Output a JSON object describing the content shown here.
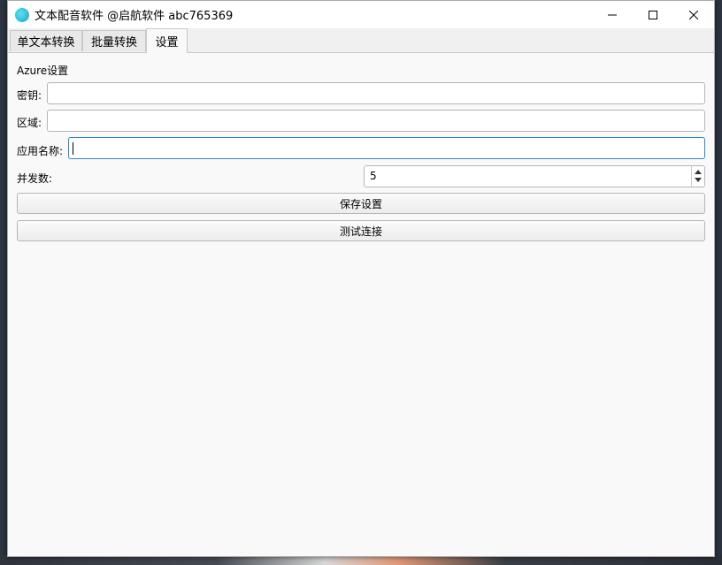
{
  "window": {
    "title": "文本配音软件 @启航软件 abc765369",
    "icon": "app-icon"
  },
  "tabs": [
    {
      "label": "单文本转换",
      "active": false
    },
    {
      "label": "批量转换",
      "active": false
    },
    {
      "label": "设置",
      "active": true
    }
  ],
  "settings": {
    "section_title": "Azure设置",
    "key_label": "密钥:",
    "key_value": "",
    "region_label": "区域:",
    "region_value": "",
    "app_name_label": "应用名称:",
    "app_name_value": "",
    "concurrency_label": "并发数:",
    "concurrency_value": "5",
    "save_button": "保存设置",
    "test_button": "测试连接"
  },
  "colors": {
    "focus_border": "#2b86c4",
    "window_bg": "#f9f9f9"
  }
}
